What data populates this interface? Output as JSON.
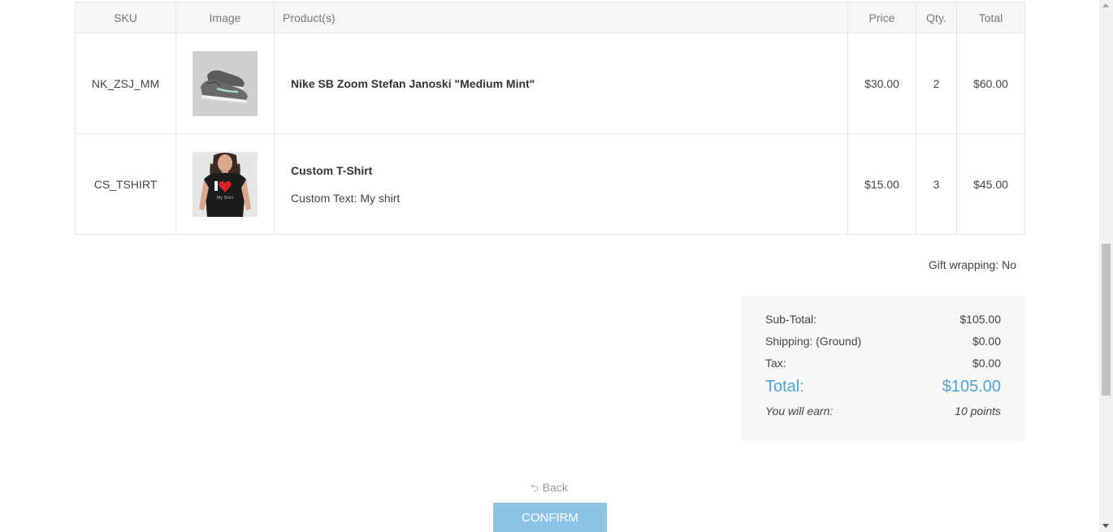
{
  "table": {
    "headers": {
      "sku": "SKU",
      "image": "Image",
      "products": "Product(s)",
      "price": "Price",
      "qty": "Qty.",
      "total": "Total"
    },
    "rows": [
      {
        "sku": "NK_ZSJ_MM",
        "image_icon": "sneaker-image",
        "name": "Nike SB Zoom Stefan Janoski \"Medium Mint\"",
        "option": "",
        "price": "$30.00",
        "qty": "2",
        "total": "$60.00"
      },
      {
        "sku": "CS_TSHIRT",
        "image_icon": "tshirt-image",
        "name": "Custom T-Shirt",
        "option": "Custom Text: My shirt",
        "price": "$15.00",
        "qty": "3",
        "total": "$45.00"
      }
    ]
  },
  "gift_wrapping": "Gift wrapping: No",
  "totals": {
    "subtotal_label": "Sub-Total:",
    "subtotal_value": "$105.00",
    "shipping_label": "Shipping: (Ground)",
    "shipping_value": "$0.00",
    "tax_label": "Tax:",
    "tax_value": "$0.00",
    "total_label": "Total:",
    "total_value": "$105.00",
    "earn_label": "You will earn:",
    "earn_value": "10 points"
  },
  "actions": {
    "back_label": "Back",
    "back_icon": "back-arrow-icon",
    "confirm_label": "CONFIRM"
  },
  "colors": {
    "accent": "#4ba3de",
    "confirm_bg": "#8cc3e6",
    "header_bg": "#f6f6f6",
    "totals_bg": "#f7f7f7"
  }
}
